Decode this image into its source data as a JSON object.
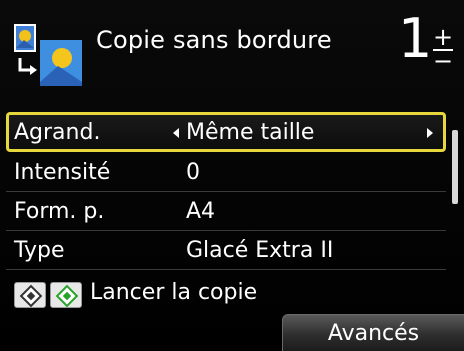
{
  "header": {
    "title": "Copie sans bordure",
    "copies": "1",
    "mode_icon": "borderless-copy-icon"
  },
  "settings": [
    {
      "label": "Agrand.",
      "value": "Même taille",
      "selected": true
    },
    {
      "label": "Intensité",
      "value": "0",
      "selected": false
    },
    {
      "label": "Form. p.",
      "value": "A4",
      "selected": false
    },
    {
      "label": "Type",
      "value": "Glacé Extra II",
      "selected": false
    }
  ],
  "start": {
    "label": "Lancer la copie",
    "mono_icon": "black-start-key-icon",
    "color_icon": "color-start-key-icon"
  },
  "advanced_button": "Avancés",
  "colors": {
    "selection_border": "#e6d73c",
    "color_key": "#2aa12a",
    "background": "#000000"
  }
}
